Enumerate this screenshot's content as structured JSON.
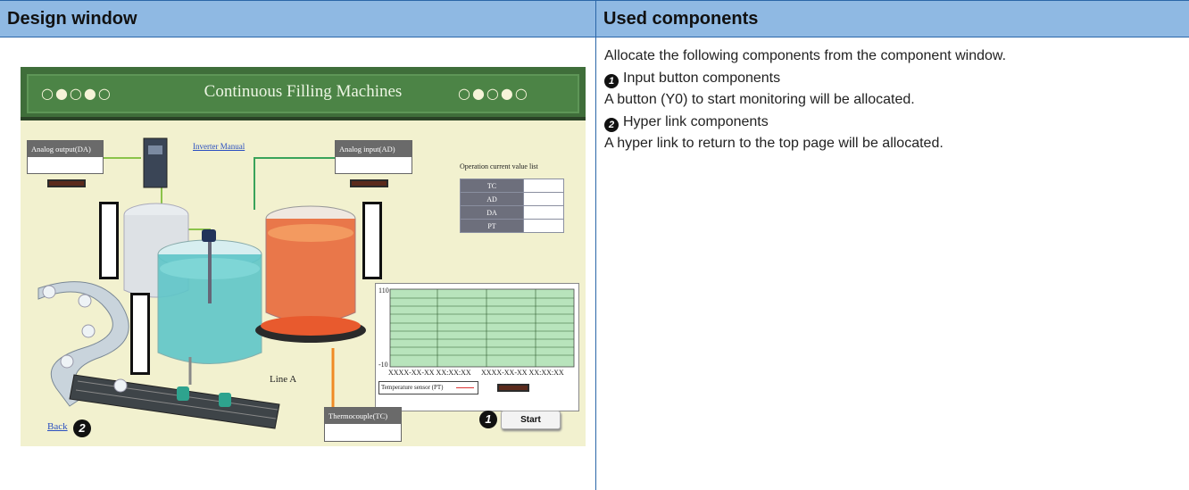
{
  "headers": {
    "design_window": "Design window",
    "used_components": "Used components"
  },
  "description": {
    "intro": "Allocate the following components from the component window.",
    "items": [
      {
        "badge": "1",
        "title": "Input button components",
        "text": "A button (Y0) to start monitoring will be allocated."
      },
      {
        "badge": "2",
        "title": "Hyper link components",
        "text": "A hyper link to return to the top page will be allocated."
      }
    ]
  },
  "screen": {
    "title": "Continuous Filling Machines",
    "dots_left": "○●○●○",
    "dots_right": "○●○●○",
    "analog_output_label": "Analog output(DA)",
    "analog_input_label": "Analog input(AD)",
    "inverter_link": "Inverter Manual",
    "thermocouple_label": "Thermocouple(TC)",
    "value_list_title": "Operation current value list",
    "value_list": [
      "TC",
      "AD",
      "DA",
      "PT"
    ],
    "line_label": "Line A",
    "back_link": "Back",
    "back_badge": "2",
    "start_button": "Start",
    "start_badge": "1",
    "chart": {
      "y_max": "110",
      "y_min": "-10",
      "x_labels": [
        "XXXX-XX-XX XX:XX:XX",
        "XXXX-XX-XX XX:XX:XX"
      ],
      "legend": "Temperature sensor (PT)"
    }
  },
  "colors": {
    "header_bg": "#8fb9e3",
    "rule": "#2b66a8",
    "banner": "#3f6e3a",
    "screen_bg": "#f2f1cf",
    "grid_bg": "#b8e4bc"
  }
}
